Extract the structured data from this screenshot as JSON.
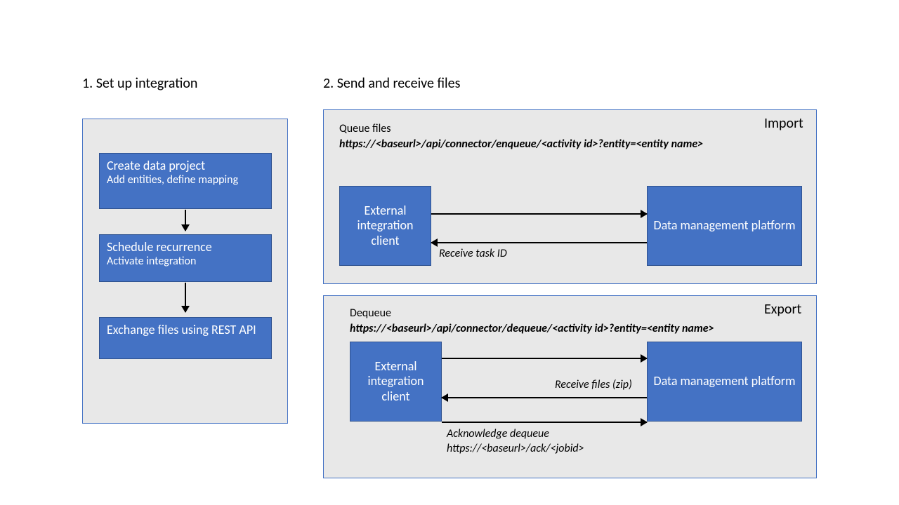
{
  "headings": {
    "h1": "1.   Set up integration",
    "h2": "2. Send and receive files"
  },
  "steps": {
    "s1_title": "Create data project",
    "s1_sub": "Add entities, define mapping",
    "s2_title": "Schedule recurrence",
    "s2_sub": "Activate integration",
    "s3_title": "Exchange files using REST API"
  },
  "import": {
    "title": "Import",
    "label": "Queue files",
    "url": "https://<baseurl>/api/connector/enqueue/<activity id>?entity=<entity name>",
    "left_node": "External integration client",
    "right_node": "Data management platform",
    "conn_label": "Receive task ID"
  },
  "export": {
    "title": "Export",
    "label": "Dequeue",
    "url": "https://<baseurl>/api/connector/dequeue/<activity id>?entity=<entity name>",
    "left_node": "External integration client",
    "right_node": "Data management platform",
    "conn1_label": "Receive files (zip)",
    "conn2_label1": "Acknowledge dequeue",
    "conn2_label2": "https://<baseurl>/ack/<jobid>"
  }
}
